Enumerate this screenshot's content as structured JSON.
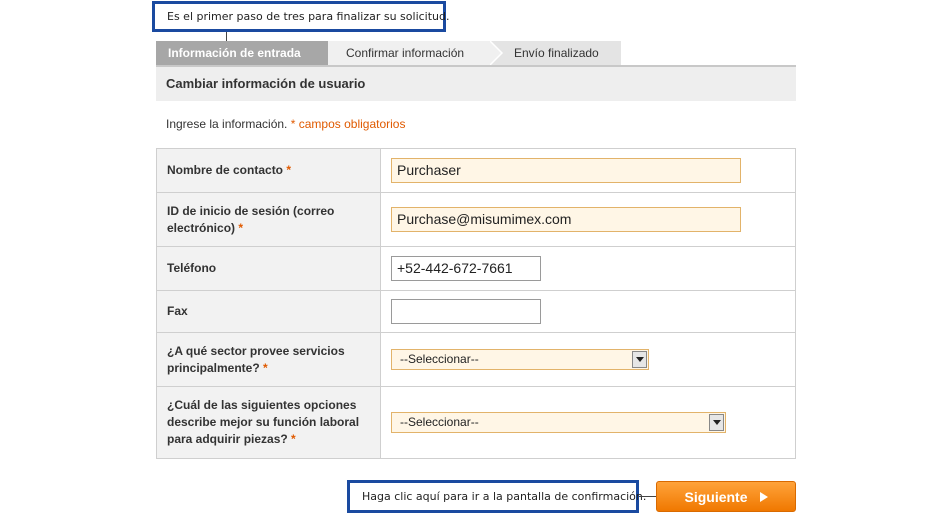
{
  "tooltips": {
    "top": "Es el primer paso de tres para finalizar su solicitud.",
    "bottom": "Haga clic aquí para ir a la pantalla de confirmación."
  },
  "steps": [
    {
      "label": "Información de entrada",
      "active": true
    },
    {
      "label": "Confirmar información",
      "active": false
    },
    {
      "label": "Envío finalizado",
      "active": false
    }
  ],
  "section_title": "Cambiar información de usuario",
  "intro": {
    "text": "Ingrese la información.",
    "required_note": "* campos obligatorios"
  },
  "form": {
    "required_mark": "*",
    "contact_name": {
      "label": "Nombre de contacto",
      "value": "Purchaser"
    },
    "login_id": {
      "label": "ID de inicio de sesión (correo electrónico)",
      "value": "Purchase@misumimex.com"
    },
    "phone": {
      "label": "Teléfono",
      "value": "+52-442-672-7661"
    },
    "fax": {
      "label": "Fax",
      "value": ""
    },
    "sector": {
      "label": "¿A qué sector provee servicios principalmente?",
      "selected": "--Seleccionar--"
    },
    "role": {
      "label": "¿Cuál de las siguientes opciones describe mejor su función laboral para adquirir piezas?",
      "selected": "--Seleccionar--"
    }
  },
  "next_button": {
    "label": "Siguiente"
  },
  "colors": {
    "accent": "#f07800",
    "required": "#e05a00",
    "callout_border": "#1a4aa0"
  }
}
